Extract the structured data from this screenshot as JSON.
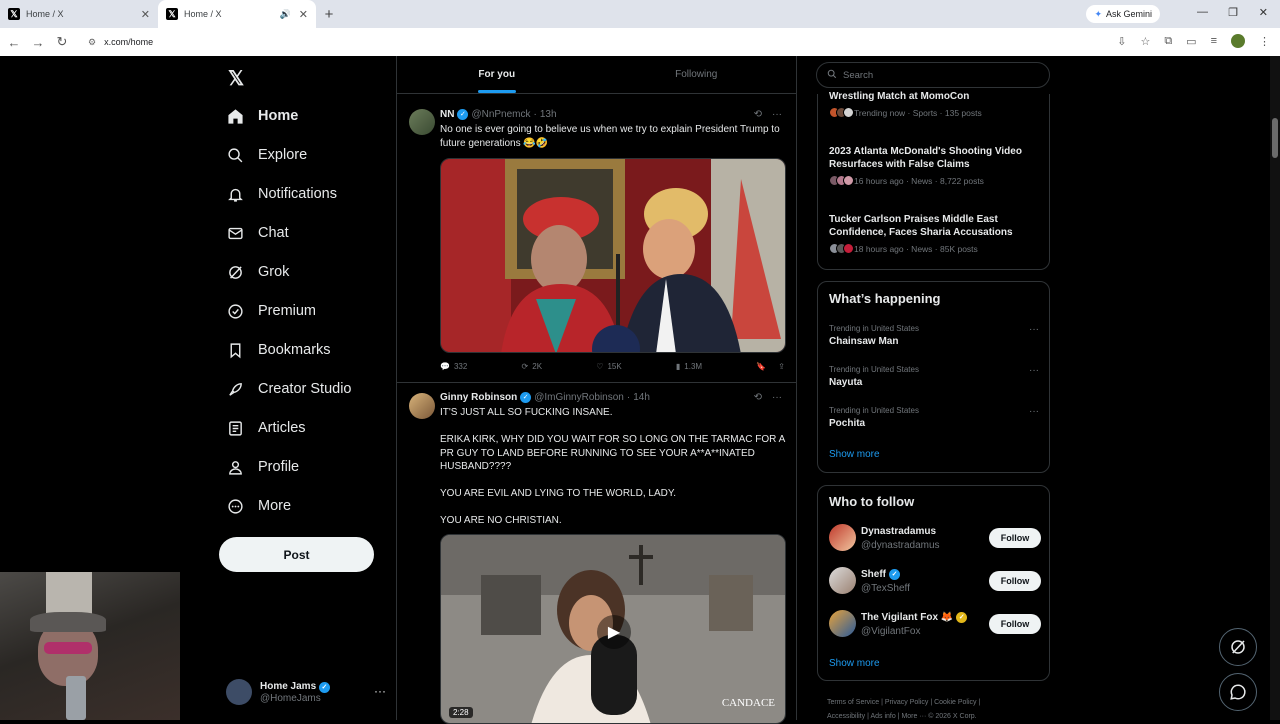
{
  "browser": {
    "tabs": [
      {
        "title": "Home / X",
        "active": false
      },
      {
        "title": "Home / X",
        "active": true
      }
    ],
    "gemini_label": "Ask Gemini",
    "url": "x.com/home"
  },
  "nav": {
    "items": [
      {
        "label": "Home",
        "icon": "home-icon"
      },
      {
        "label": "Explore",
        "icon": "search-icon"
      },
      {
        "label": "Notifications",
        "icon": "bell-icon"
      },
      {
        "label": "Chat",
        "icon": "mail-icon"
      },
      {
        "label": "Grok",
        "icon": "grok-icon"
      },
      {
        "label": "Premium",
        "icon": "verified-icon"
      },
      {
        "label": "Bookmarks",
        "icon": "bookmark-icon"
      },
      {
        "label": "Creator Studio",
        "icon": "rocket-icon"
      },
      {
        "label": "Articles",
        "icon": "article-icon"
      },
      {
        "label": "Profile",
        "icon": "person-icon"
      },
      {
        "label": "More",
        "icon": "more-circle-icon"
      }
    ],
    "post_label": "Post",
    "account": {
      "name": "Home Jams",
      "handle": "@HomeJams"
    }
  },
  "feed": {
    "tabs": [
      "For you",
      "Following"
    ],
    "tweets": [
      {
        "name": "NN",
        "handle": "@NnPnemck",
        "time": "13h",
        "text": "No one is ever going to believe us when we try to explain President Trump to future generations 😂🤣",
        "replies": "332",
        "reposts": "2K",
        "likes": "15K",
        "views": "1.3M"
      },
      {
        "name": "Ginny Robinson",
        "handle": "@ImGinnyRobinson",
        "time": "14h",
        "text": "IT'S JUST ALL SO FUCKING INSANE.\n\nERIKA KIRK, WHY DID YOU WAIT FOR SO LONG ON THE TARMAC FOR A PR GUY TO LAND BEFORE RUNNING TO SEE YOUR A**A**INATED HUSBAND????\n\nYOU ARE EVIL AND LYING TO THE WORLD, LADY.\n\nYOU ARE NO CHRISTIAN.",
        "video_duration": "2:28",
        "video_watermark": "CANDACE"
      }
    ]
  },
  "right": {
    "search_placeholder": "Search",
    "trends": [
      {
        "title": "Wrestling Match at MomoCon",
        "meta": "Trending now · Sports · 135 posts"
      },
      {
        "title": "2023 Atlanta McDonald's Shooting Video Resurfaces with False Claims",
        "meta": "16 hours ago · News · 8,722 posts"
      },
      {
        "title": "Tucker Carlson Praises Middle East Confidence, Faces Sharia Accusations",
        "meta": "18 hours ago · News · 85K posts"
      }
    ],
    "happening": {
      "title": "What’s happening",
      "items": [
        {
          "context": "Trending in United States",
          "name": "Chainsaw Man"
        },
        {
          "context": "Trending in United States",
          "name": "Nayuta"
        },
        {
          "context": "Trending in United States",
          "name": "Pochita"
        }
      ],
      "show_more": "Show more"
    },
    "who_to_follow": {
      "title": "Who to follow",
      "accounts": [
        {
          "name": "Dynastradamus",
          "handle": "@dynastradamus",
          "verified": false,
          "follow": "Follow"
        },
        {
          "name": "Sheff",
          "handle": "@TexSheff",
          "verified": true,
          "follow": "Follow"
        },
        {
          "name": "The Vigilant Fox 🦊",
          "handle": "@VigilantFox",
          "verified": true,
          "follow": "Follow"
        }
      ],
      "show_more": "Show more"
    },
    "footer_line1": "Terms of Service  |  Privacy Policy  |  Cookie Policy  |",
    "footer_line2": "Accessibility  |  Ads info  |  More ···  © 2026 X Corp."
  },
  "colors": {
    "accent": "#1d9bf0",
    "background": "#000000",
    "border": "#2f3336",
    "muted": "#71767b"
  }
}
